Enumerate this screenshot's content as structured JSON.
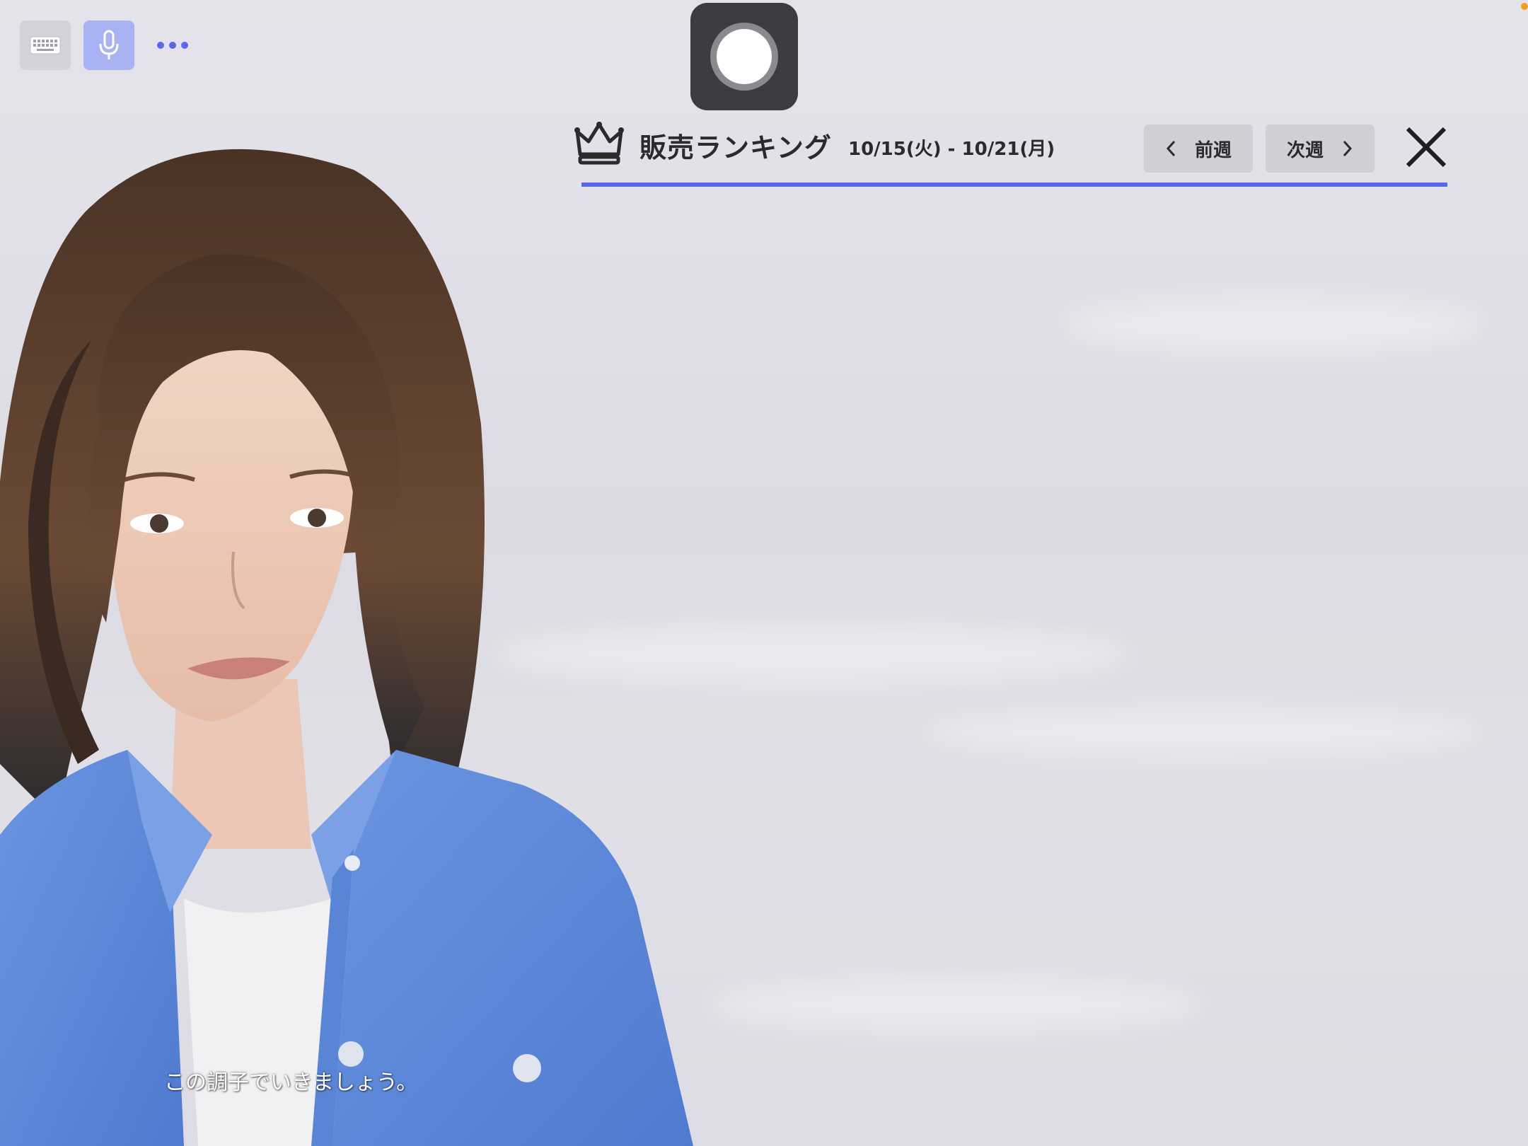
{
  "toolbar": {
    "keyboard_icon": "keyboard-icon",
    "mic_icon": "microphone-icon",
    "more_icon": "more-dots-icon",
    "accent_color": "#a9b2f3"
  },
  "record": {
    "icon": "record-icon"
  },
  "ranking": {
    "title": "販売ランキング",
    "date_range": "10/15(火) - 10/21(月)",
    "prev_label": "前週",
    "next_label": "次週",
    "crown_icon": "crown-icon",
    "close_icon": "close-icon",
    "underline_color": "#5b68e6"
  },
  "avatar": {
    "subtitle": "この調子でいきましょう。"
  }
}
